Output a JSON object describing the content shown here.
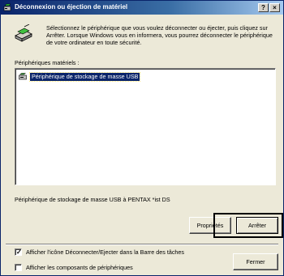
{
  "window": {
    "title": "Déconnexion ou éjection de matériel",
    "help_label": "?",
    "close_label": "×"
  },
  "intro": {
    "text": "Sélectionnez le périphérique que vous voulez déconnecter ou éjecter, puis cliquez sur Arrêter. Lorsque Windows vous en informera, vous pourrez déconnecter le périphérique de votre ordinateur en toute sécurité."
  },
  "hardware": {
    "label": "Périphériques matériels :",
    "items": [
      {
        "label": "Périphérique de stockage de masse USB",
        "icon": "usb-device-icon",
        "selected": true
      }
    ],
    "selected_description": "Périphérique de stockage de masse USB à PENTAX *ist DS"
  },
  "buttons": {
    "properties": "Propriétés",
    "stop": "Arrêter",
    "close": "Fermer"
  },
  "options": {
    "show_icon": {
      "label": "Afficher l'icône Déconnecter/Ejecter dans la Barre des tâches",
      "checked": true,
      "mark": "✓"
    },
    "show_components": {
      "label": "Afficher les composants de périphériques",
      "checked": false
    }
  },
  "colors": {
    "title_bar": "#0a246a",
    "selection": "#0a246a",
    "face": "#ece9d8"
  }
}
